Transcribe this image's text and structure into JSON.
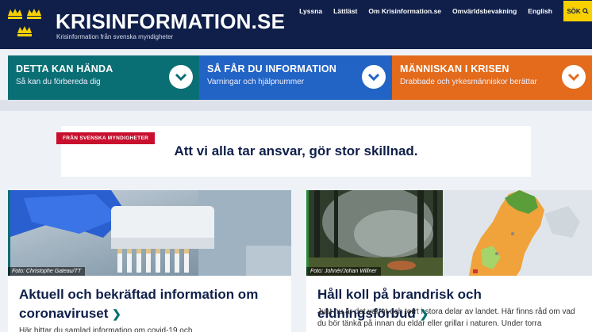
{
  "header": {
    "brand": "KRISINFORMATION.SE",
    "tagline": "Krisinformation från svenska myndigheter",
    "nav": [
      "Lyssna",
      "Lättläst",
      "Om Krisinformation.se",
      "Omvärldsbevakning",
      "English"
    ],
    "search_label": "SÖK"
  },
  "tiles": [
    {
      "title": "DETTA KAN HÄNDA",
      "subtitle": "Så kan du förbereda dig"
    },
    {
      "title": "SÅ FÅR DU INFORMATION",
      "subtitle": "Varningar och hjälpnummer"
    },
    {
      "title": "MÄNNISKAN I KRISEN",
      "subtitle": "Drabbade och yrkesmänniskor berättar"
    }
  ],
  "banner": {
    "tag": "FRÅN SVENSKA MYNDIGHETER",
    "text": "Att vi alla tar ansvar, gör stor skillnad."
  },
  "cards": [
    {
      "credit": "Foto: Christophe Gateau/TT",
      "title": "Aktuell och bekräftad information om coronaviruset",
      "text": "Här hittar du samlad information om covid-19 och"
    },
    {
      "credit": "Foto: Johnér/Johan Willner",
      "title": "Håll koll på brandrisk och eldningsförbud",
      "text": "Just nu är det varmt och torrt i stora delar av landet. Här finns råd om vad du bör tänka på innan du eldar eller grillar i naturen. Under torra"
    }
  ],
  "colors": {
    "header_bg": "#0f1f4a",
    "tile1": "#0a6f74",
    "tile2": "#2264c5",
    "tile3": "#e36b1b",
    "search_bg": "#f8d000",
    "banner_tag": "#c8102e"
  }
}
